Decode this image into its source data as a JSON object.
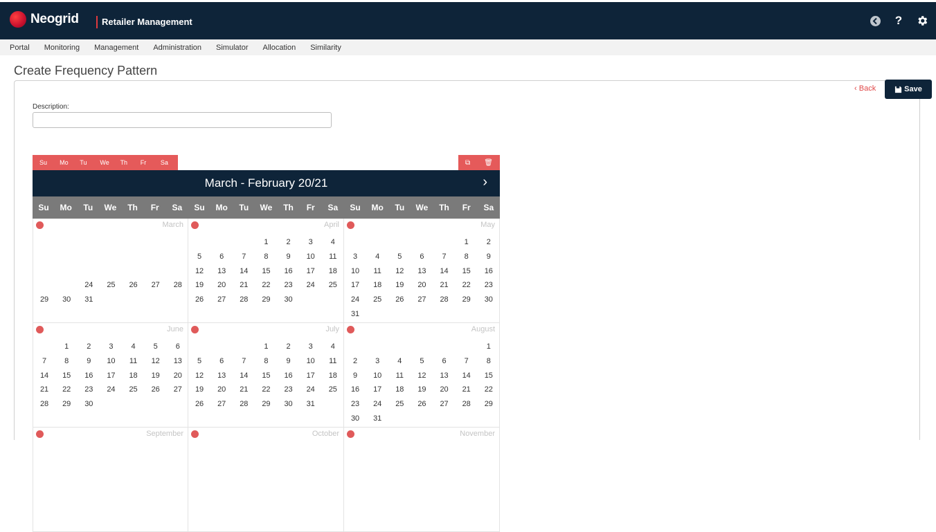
{
  "header": {
    "brand": "Neogrid",
    "app_title": "Retailer Management",
    "icons": [
      "back-circle-icon",
      "help-icon",
      "gear-icon"
    ]
  },
  "nav": {
    "items": [
      "Portal",
      "Monitoring",
      "Management",
      "Administration",
      "Simulator",
      "Allocation",
      "Similarity"
    ]
  },
  "page": {
    "title": "Create Frequency Pattern",
    "back_label": "Back",
    "save_label": "Save"
  },
  "form": {
    "description_label": "Description:",
    "description_value": ""
  },
  "day_selector": [
    "Su",
    "Mo",
    "Tu",
    "We",
    "Th",
    "Fr",
    "Sa"
  ],
  "calendar": {
    "title": "March - February  20/21",
    "dow": [
      "Su",
      "Mo",
      "Tu",
      "We",
      "Th",
      "Fr",
      "Sa"
    ],
    "months": [
      {
        "name": "March",
        "weeks": [
          [
            "",
            "",
            "",
            "",
            "",
            "",
            ""
          ],
          [
            "",
            "",
            "",
            "",
            "",
            "",
            ""
          ],
          [
            "",
            "",
            "",
            "",
            "",
            "",
            ""
          ],
          [
            "",
            "",
            "24",
            "25",
            "26",
            "27",
            "28"
          ],
          [
            "29",
            "30",
            "31",
            "",
            "",
            "",
            ""
          ]
        ]
      },
      {
        "name": "April",
        "weeks": [
          [
            "",
            "",
            "",
            "1",
            "2",
            "3",
            "4"
          ],
          [
            "5",
            "6",
            "7",
            "8",
            "9",
            "10",
            "11"
          ],
          [
            "12",
            "13",
            "14",
            "15",
            "16",
            "17",
            "18"
          ],
          [
            "19",
            "20",
            "21",
            "22",
            "23",
            "24",
            "25"
          ],
          [
            "26",
            "27",
            "28",
            "29",
            "30",
            "",
            ""
          ]
        ]
      },
      {
        "name": "May",
        "weeks": [
          [
            "",
            "",
            "",
            "",
            "",
            "1",
            "2"
          ],
          [
            "3",
            "4",
            "5",
            "6",
            "7",
            "8",
            "9"
          ],
          [
            "10",
            "11",
            "12",
            "13",
            "14",
            "15",
            "16"
          ],
          [
            "17",
            "18",
            "19",
            "20",
            "21",
            "22",
            "23"
          ],
          [
            "24",
            "25",
            "26",
            "27",
            "28",
            "29",
            "30"
          ],
          [
            "31",
            "",
            "",
            "",
            "",
            "",
            ""
          ]
        ]
      },
      {
        "name": "June",
        "weeks": [
          [
            "",
            "1",
            "2",
            "3",
            "4",
            "5",
            "6"
          ],
          [
            "7",
            "8",
            "9",
            "10",
            "11",
            "12",
            "13"
          ],
          [
            "14",
            "15",
            "16",
            "17",
            "18",
            "19",
            "20"
          ],
          [
            "21",
            "22",
            "23",
            "24",
            "25",
            "26",
            "27"
          ],
          [
            "28",
            "29",
            "30",
            "",
            "",
            "",
            ""
          ]
        ]
      },
      {
        "name": "July",
        "weeks": [
          [
            "",
            "",
            "",
            "1",
            "2",
            "3",
            "4"
          ],
          [
            "5",
            "6",
            "7",
            "8",
            "9",
            "10",
            "11"
          ],
          [
            "12",
            "13",
            "14",
            "15",
            "16",
            "17",
            "18"
          ],
          [
            "19",
            "20",
            "21",
            "22",
            "23",
            "24",
            "25"
          ],
          [
            "26",
            "27",
            "28",
            "29",
            "30",
            "31",
            ""
          ]
        ]
      },
      {
        "name": "August",
        "weeks": [
          [
            "",
            "",
            "",
            "",
            "",
            "",
            "1"
          ],
          [
            "2",
            "3",
            "4",
            "5",
            "6",
            "7",
            "8"
          ],
          [
            "9",
            "10",
            "11",
            "12",
            "13",
            "14",
            "15"
          ],
          [
            "16",
            "17",
            "18",
            "19",
            "20",
            "21",
            "22"
          ],
          [
            "23",
            "24",
            "25",
            "26",
            "27",
            "28",
            "29"
          ],
          [
            "30",
            "31",
            "",
            "",
            "",
            "",
            ""
          ]
        ]
      },
      {
        "name": "September",
        "weeks": []
      },
      {
        "name": "October",
        "weeks": []
      },
      {
        "name": "November",
        "weeks": []
      }
    ]
  }
}
